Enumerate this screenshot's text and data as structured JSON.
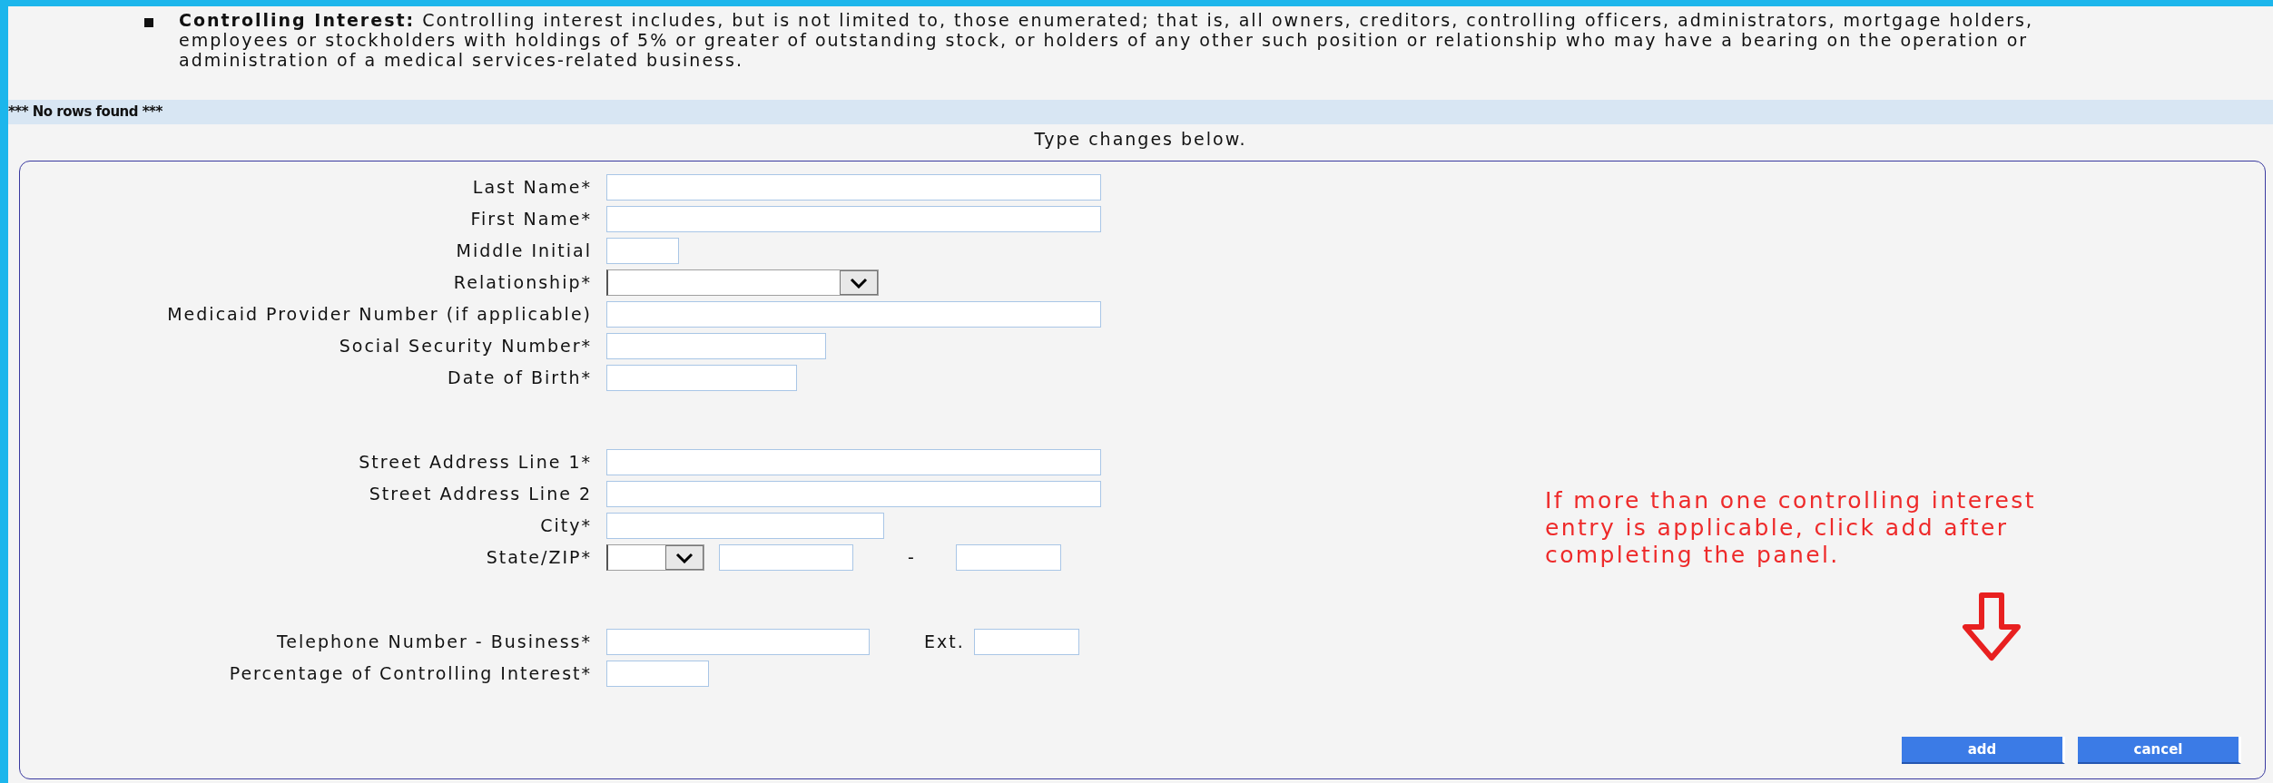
{
  "intro": {
    "text": "**Controlling Interest:** Controlling interest includes, but is not limited to, those enumerated; that is, all owners, creditors, controlling officers, administrators, mortgage holders, employees or stockholders with holdings of 5% or greater of outstanding stock, or holders of any other such position or relationship who may have a bearing on the operation or administration of a medical services-related business."
  },
  "notice": "*** No rows found ***",
  "instruction": "Type changes below.",
  "sections": [
    [
      {
        "label": "Last Name*",
        "kind": "text"
      },
      {
        "label": "First Name*",
        "kind": "text"
      },
      {
        "label": "Middle Initial",
        "kind": "text"
      },
      {
        "label": "Relationship*",
        "kind": "select"
      },
      {
        "label": "Medicaid Provider Number (if applicable)",
        "kind": "text"
      },
      {
        "label": "Social Security Number*",
        "kind": "text"
      },
      {
        "label": "Date of Birth*",
        "kind": "text"
      }
    ],
    [
      {
        "label": "Street Address Line 1*",
        "kind": "text"
      },
      {
        "label": "Street Address Line 2",
        "kind": "text"
      },
      {
        "label": "City*",
        "kind": "text"
      },
      {
        "label": "State/ZIP*",
        "kind": "statezip",
        "separator": "-"
      }
    ],
    [
      {
        "label": "Telephone Number - Business*",
        "kind": "phone",
        "ext_label": "Ext."
      },
      {
        "label": "Percentage of Controlling Interest*",
        "kind": "text"
      }
    ]
  ],
  "note": "If more than one controlling interest entry is applicable, click add after completing the panel.",
  "buttons": [
    "add",
    "cancel"
  ]
}
